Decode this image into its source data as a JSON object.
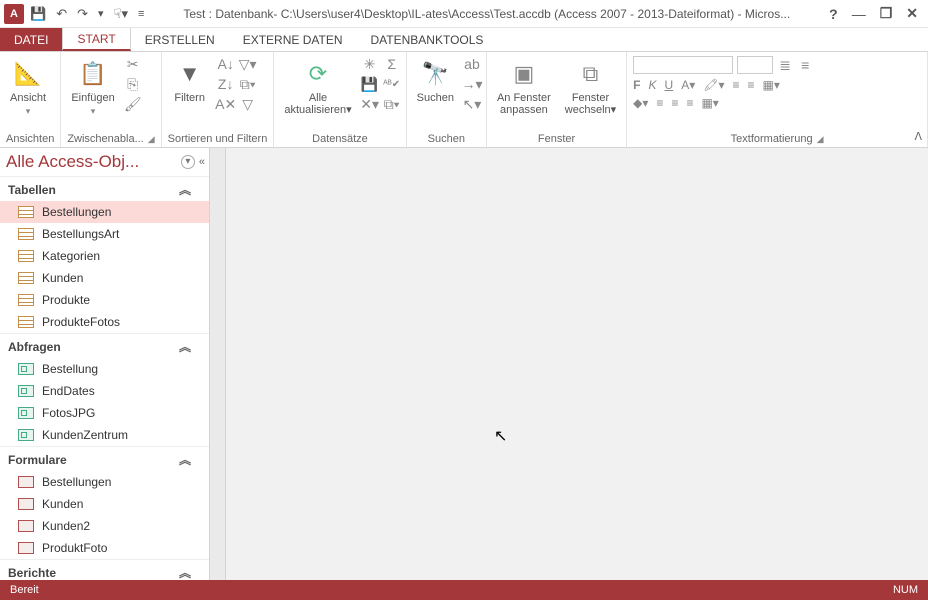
{
  "titlebar": {
    "app_letter": "A",
    "title": "Test : Datenbank- C:\\Users\\user4\\Desktop\\IL-ates\\Access\\Test.accdb (Access 2007 - 2013-Dateiformat) - Micros..."
  },
  "tabs": {
    "file": "DATEI",
    "start": "START",
    "erstellen": "ERSTELLEN",
    "externe": "EXTERNE DATEN",
    "tools": "DATENBANKTOOLS"
  },
  "ribbon": {
    "ansicht": "Ansicht",
    "einfuegen": "Einfügen",
    "filtern": "Filtern",
    "alle_akt": "Alle",
    "alle_akt2": "aktualisieren",
    "suchen": "Suchen",
    "anfenster": "An Fenster",
    "anfenster2": "anpassen",
    "fenster_w": "Fenster",
    "fenster_w2": "wechseln",
    "group_ansichten": "Ansichten",
    "group_zwischen": "Zwischenabla...",
    "group_sortfilter": "Sortieren und Filtern",
    "group_datensaetze": "Datensätze",
    "group_suchen": "Suchen",
    "group_fenster": "Fenster",
    "group_textformat": "Textformatierung"
  },
  "nav": {
    "title": "Alle Access-Obj...",
    "cats": {
      "tabellen": "Tabellen",
      "abfragen": "Abfragen",
      "formulare": "Formulare",
      "berichte": "Berichte"
    },
    "tables": [
      "Bestellungen",
      "BestellungsArt",
      "Kategorien",
      "Kunden",
      "Produkte",
      "ProdukteFotos"
    ],
    "queries": [
      "Bestellung",
      "EndDates",
      "FotosJPG",
      "KundenZentrum"
    ],
    "forms": [
      "Bestellungen",
      "Kunden",
      "Kunden2",
      "ProduktFoto"
    ]
  },
  "status": {
    "ready": "Bereit",
    "num": "NUM"
  }
}
